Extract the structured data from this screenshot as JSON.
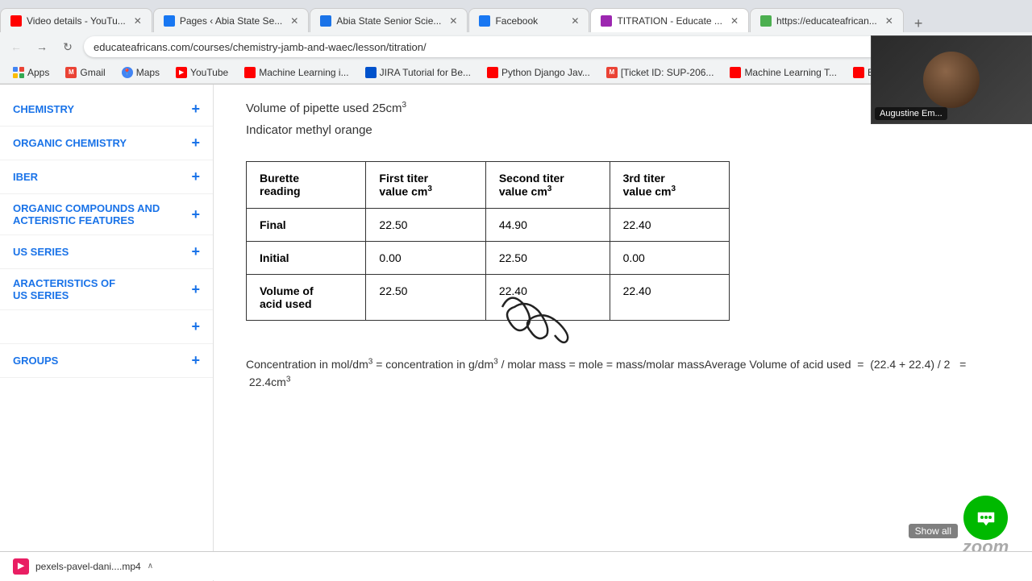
{
  "browser": {
    "tabs": [
      {
        "id": "tab1",
        "title": "Video details - YouTu...",
        "favicon_color": "#ff0000",
        "active": false
      },
      {
        "id": "tab2",
        "title": "Pages ‹ Abia State Se...",
        "favicon_color": "#1877f2",
        "active": false
      },
      {
        "id": "tab3",
        "title": "Abia State Senior Scie...",
        "favicon_color": "#1a73e8",
        "active": false
      },
      {
        "id": "tab4",
        "title": "Facebook",
        "favicon_color": "#1877f2",
        "active": false
      },
      {
        "id": "tab5",
        "title": "TITRATION - Educate ...",
        "favicon_color": "#9c27b0",
        "active": true
      },
      {
        "id": "tab6",
        "title": "https://educateafrican...",
        "favicon_color": "#4caf50",
        "active": false
      }
    ],
    "address": "educateafricans.com/courses/chemistry-jamb-and-waec/lesson/titration/",
    "bookmarks": [
      {
        "label": "Apps",
        "icon": "grid"
      },
      {
        "label": "Gmail",
        "icon": "email",
        "color": "#ea4335"
      },
      {
        "label": "Maps",
        "icon": "map",
        "color": "#4285f4"
      },
      {
        "label": "YouTube",
        "icon": "yt",
        "color": "#ff0000"
      },
      {
        "label": "Machine Learning i...",
        "icon": "yt",
        "color": "#ff0000"
      },
      {
        "label": "JIRA Tutorial for Be...",
        "icon": "jira",
        "color": "#0052cc"
      },
      {
        "label": "Python Django Jav...",
        "icon": "yt",
        "color": "#ff0000"
      },
      {
        "label": "[Ticket ID: SUP-206...",
        "icon": "gmail",
        "color": "#ea4335"
      },
      {
        "label": "Machine Learning T...",
        "icon": "yt",
        "color": "#ff0000"
      },
      {
        "label": "Build a ...",
        "icon": "yt",
        "color": "#ff0000"
      }
    ]
  },
  "sidebar": {
    "items": [
      {
        "label": "CHEMISTRY",
        "has_plus": true
      },
      {
        "label": "ORGANIC CHEMISTRY",
        "has_plus": true
      },
      {
        "label": "IBER",
        "has_plus": true
      },
      {
        "label": "ORGANIC COMPOUNDS AND ACTERISTIC FEATURES",
        "has_plus": true
      },
      {
        "label": "US SERIES",
        "has_plus": true
      },
      {
        "label": "ARACTERISTICS OF US SERIES",
        "has_plus": true
      },
      {
        "label": "",
        "has_plus": true
      },
      {
        "label": "GROUPS",
        "has_plus": true
      }
    ]
  },
  "main": {
    "volume_pipette": "Volume of pipette used 25cm",
    "indicator": "Indicator methyl orange",
    "table": {
      "headers": [
        "Burette reading",
        "First titer value cm",
        "Second titer value cm",
        "3rd titer value cm"
      ],
      "rows": [
        {
          "label": "Final",
          "col1": "22.50",
          "col2": "44.90",
          "col3": "22.40"
        },
        {
          "label": "Initial",
          "col1": "0.00",
          "col2": "22.50",
          "col3": "0.00"
        },
        {
          "label": "Volume of acid used",
          "col1": "22.50",
          "col2": "22.40",
          "col3": "22.40"
        }
      ]
    },
    "formula": "Concentration in mol/dm³ = concentration in g/dm³ / molar mass = mole = mass/molar massAverage Volume of acid used  =  (22.4 + 22.4) / 2   =  22.4cm³"
  },
  "video_call": {
    "name": "Augustine Em..."
  },
  "download": {
    "filename": "pexels-pavel-dani....mp4",
    "icon_text": "MP4",
    "show_all": "Show all"
  },
  "zoom": {
    "label": "zoom"
  }
}
